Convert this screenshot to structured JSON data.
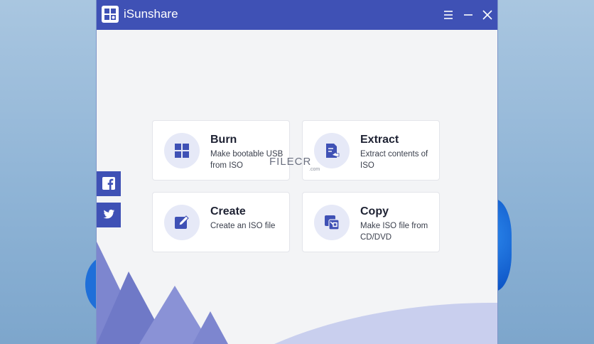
{
  "window": {
    "title": "iSunshare"
  },
  "cards": [
    {
      "title": "Burn",
      "description": "Make bootable USB from ISO",
      "icon": "grid-icon"
    },
    {
      "title": "Extract",
      "description": "Extract contents of ISO",
      "icon": "extract-document-icon"
    },
    {
      "title": "Create",
      "description": "Create an ISO file",
      "icon": "edit-icon"
    },
    {
      "title": "Copy",
      "description": "Make ISO file from CD/DVD",
      "icon": "copy-arrow-icon"
    }
  ],
  "watermark": {
    "text": "FILECR",
    "suffix": ".com"
  },
  "social": [
    {
      "name": "facebook",
      "icon": "facebook-icon"
    },
    {
      "name": "twitter",
      "icon": "twitter-icon"
    }
  ],
  "colors": {
    "accent": "#3f51b5",
    "icon_circle": "#e6e9f7",
    "background": "#f3f4f6"
  }
}
